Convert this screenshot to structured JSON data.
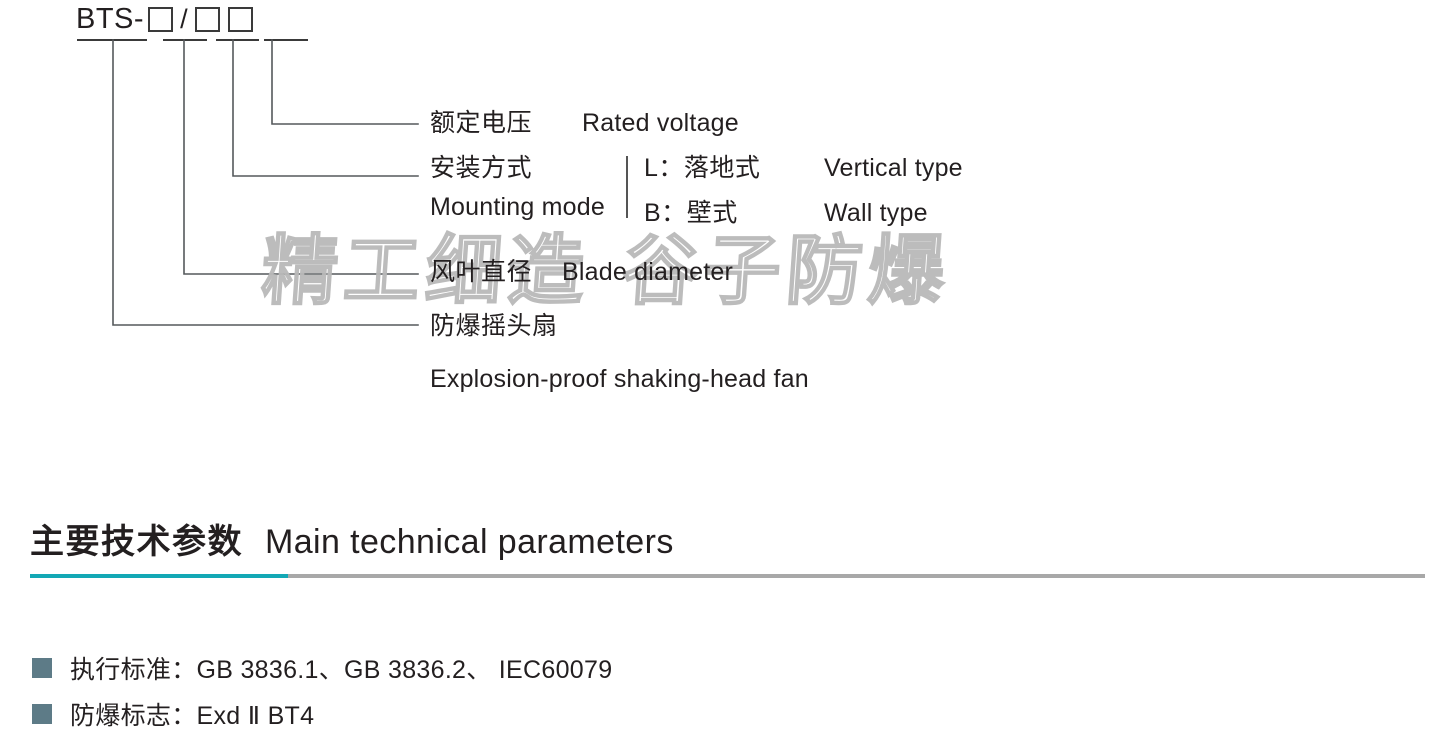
{
  "model_code": {
    "prefix": "BTS-",
    "slash": "/",
    "boxes": [
      "",
      "",
      ""
    ]
  },
  "callouts": {
    "rated_voltage": {
      "cn": "额定电压",
      "en": "Rated voltage"
    },
    "mounting_mode": {
      "cn": "安装方式",
      "en": "Mounting mode",
      "options": [
        {
          "code": "L：",
          "cn": "落地式",
          "en": "Vertical type"
        },
        {
          "code": "B：",
          "cn": "壁式",
          "en": "Wall type"
        }
      ]
    },
    "blade_diameter": {
      "cn": "风叶直径",
      "en": "Blade diameter"
    },
    "product": {
      "cn": "防爆摇头扇",
      "en": "Explosion-proof shaking-head fan"
    }
  },
  "watermark": {
    "text": "精工细造 谷子防爆"
  },
  "section": {
    "heading_cn": "主要技术参数",
    "heading_en": "Main technical parameters",
    "accent_color": "#13a8b5",
    "rule_color": "#a8a8a8"
  },
  "specs": {
    "bullet_color": "#5d7b87",
    "items": [
      {
        "text": "执行标准：GB 3836.1、GB 3836.2、 IEC60079"
      },
      {
        "text": "防爆标志：Exd Ⅱ BT4"
      }
    ]
  }
}
